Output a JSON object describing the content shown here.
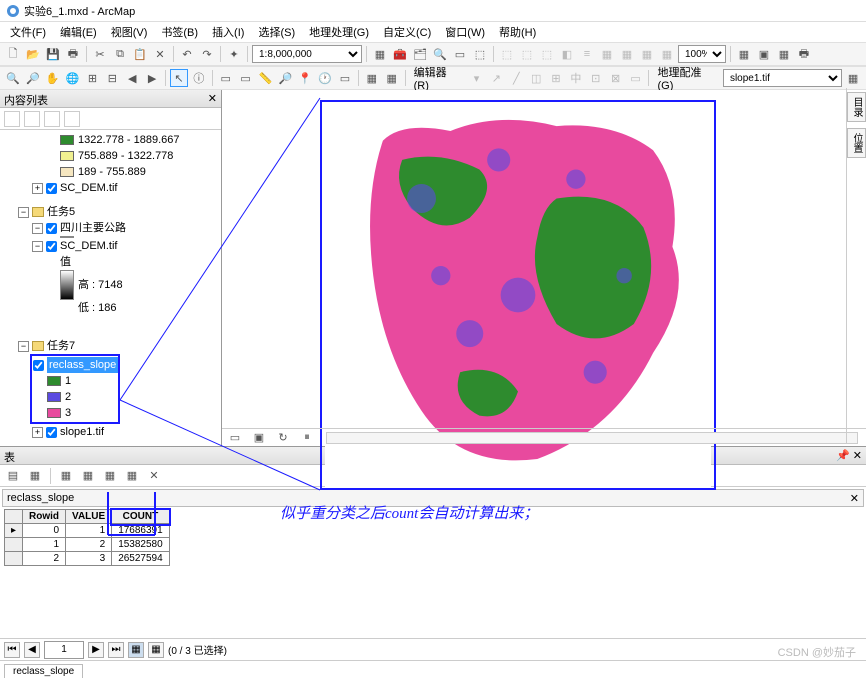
{
  "window": {
    "title": "实验6_1.mxd - ArcMap"
  },
  "menu": {
    "file": "文件(F)",
    "edit": "编辑(E)",
    "view": "视图(V)",
    "bookmark": "书签(B)",
    "insert": "插入(I)",
    "select": "选择(S)",
    "geoproc": "地理处理(G)",
    "custom": "自定义(C)",
    "window": "窗口(W)",
    "help": "帮助(H)"
  },
  "toolbar": {
    "scale": "1:8,000,000",
    "zoom": "100%",
    "editor_label": "编辑器(R)",
    "georef_label": "地理配准(G)",
    "layer_combo": "slope1.tif"
  },
  "toc": {
    "header": "内容列表",
    "legend": {
      "r1_label": "1322.778 - 1889.667",
      "r1_color": "#2e8b2e",
      "r2_label": "755.889 - 1322.778",
      "r2_color": "#f0f090",
      "r3_label": "189 - 755.889",
      "r3_color": "#f5e6c0",
      "sc_dem": "SC_DEM.tif"
    },
    "group5": {
      "name": "任务5",
      "roads": "四川主要公路",
      "dem": "SC_DEM.tif",
      "val_label": "值",
      "high": "高 : 7148",
      "low": "低 : 186"
    },
    "group7": {
      "name": "任务7",
      "reclass": "reclass_slope",
      "c1": "1",
      "c1_color": "#2e8b2e",
      "c2": "2",
      "c2_color": "#5a4ae0",
      "c3": "3",
      "c3_color": "#e84a9e",
      "slope": "slope1.tif"
    }
  },
  "table": {
    "panel_title": "表",
    "name": "reclass_slope",
    "headers": {
      "rowid": "Rowid",
      "value": "VALUE",
      "count": "COUNT"
    },
    "rows": [
      {
        "rowid": "0",
        "value": "1",
        "count": "17686391"
      },
      {
        "rowid": "1",
        "value": "2",
        "count": "15382580"
      },
      {
        "rowid": "2",
        "value": "3",
        "count": "26527594"
      }
    ],
    "nav": {
      "pos": "1",
      "status": "(0 / 3 已选择)"
    },
    "tab": "reclass_slope"
  },
  "annotation": "似乎重分类之后count会自动计算出来；",
  "rightbar": {
    "catalog": "目录",
    "pos": "位置"
  },
  "watermark": "CSDN @妙茄子"
}
